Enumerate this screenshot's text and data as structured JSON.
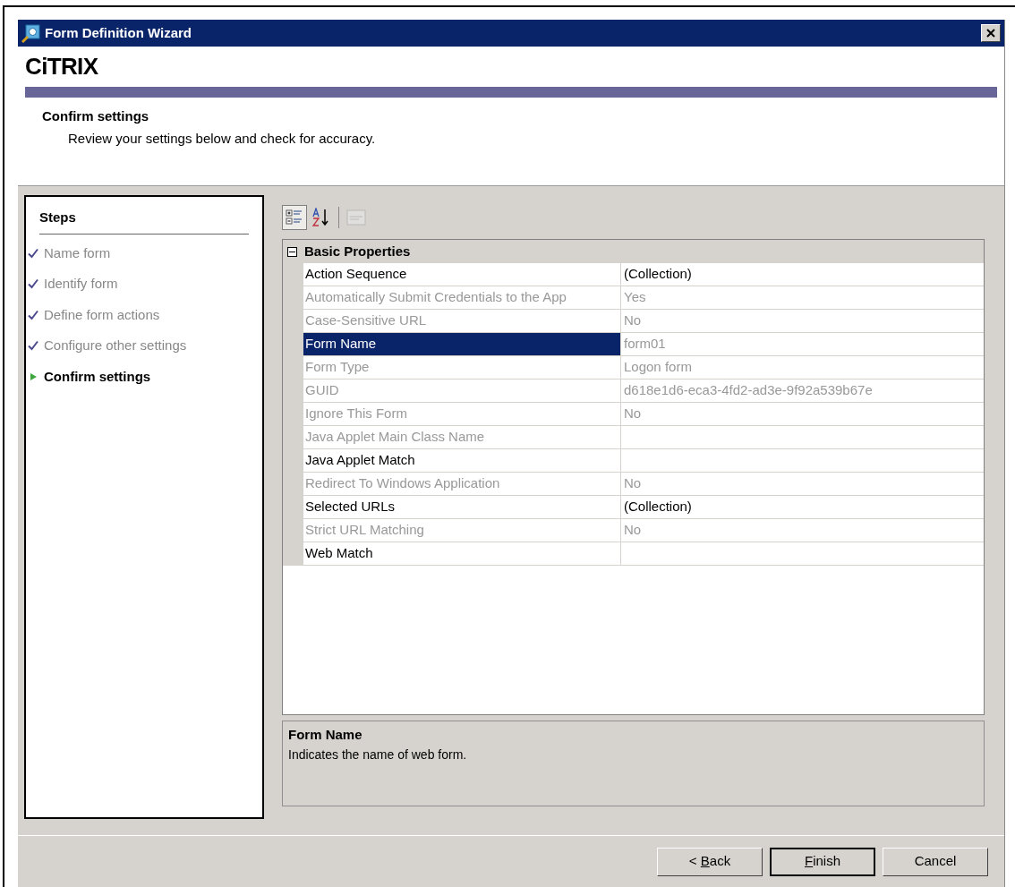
{
  "window": {
    "title": "Form Definition Wizard"
  },
  "banner": {
    "logo": "CiTRIX",
    "heading": "Confirm settings",
    "subheading": "Review your settings below and check for accuracy."
  },
  "steps": {
    "title": "Steps",
    "items": [
      {
        "label": "Name form",
        "kind": "done"
      },
      {
        "label": "Identify form",
        "kind": "done"
      },
      {
        "label": "Define form actions",
        "kind": "done"
      },
      {
        "label": "Configure other settings",
        "kind": "done"
      },
      {
        "label": "Confirm settings",
        "kind": "current"
      }
    ]
  },
  "toolbar": [
    {
      "kind": "categorized",
      "selected": true,
      "disabled": false
    },
    {
      "kind": "alphabetical",
      "selected": false,
      "disabled": false
    },
    {
      "kind": "pages",
      "selected": false,
      "disabled": true
    }
  ],
  "property_grid": {
    "category": "Basic Properties",
    "expanded": true,
    "rows": [
      {
        "name": "Action Sequence",
        "value": "(Collection)",
        "disabled": false,
        "selected": false
      },
      {
        "name": "Automatically Submit Credentials to the App",
        "value": "Yes",
        "disabled": true,
        "selected": false
      },
      {
        "name": "Case-Sensitive URL",
        "value": "No",
        "disabled": true,
        "selected": false
      },
      {
        "name": "Form Name",
        "value": "form01",
        "disabled": true,
        "selected": true
      },
      {
        "name": "Form Type",
        "value": "Logon form",
        "disabled": true,
        "selected": false
      },
      {
        "name": "GUID",
        "value": "d618e1d6-eca3-4fd2-ad3e-9f92a539b67e",
        "disabled": true,
        "selected": false
      },
      {
        "name": "Ignore This Form",
        "value": "No",
        "disabled": true,
        "selected": false
      },
      {
        "name": "Java Applet Main Class Name",
        "disabled": true,
        "selected": false
      },
      {
        "name": "Java Applet Match",
        "disabled": false,
        "selected": false
      },
      {
        "name": "Redirect To Windows Application",
        "value": "No",
        "disabled": true,
        "selected": false
      },
      {
        "name": "Selected URLs",
        "value": "(Collection)",
        "disabled": false,
        "selected": false
      },
      {
        "name": "Strict URL Matching",
        "value": "No",
        "disabled": true,
        "selected": false
      },
      {
        "name": "Web Match",
        "disabled": false,
        "selected": false
      }
    ]
  },
  "description": {
    "title": "Form Name",
    "text": "Indicates the name of web form."
  },
  "buttons": [
    {
      "before": "< ",
      "mnemonic": "B",
      "after": "ack",
      "default": false
    },
    {
      "mnemonic": "F",
      "after": "inish",
      "default": true
    },
    {
      "before": "Cancel",
      "default": false
    }
  ]
}
